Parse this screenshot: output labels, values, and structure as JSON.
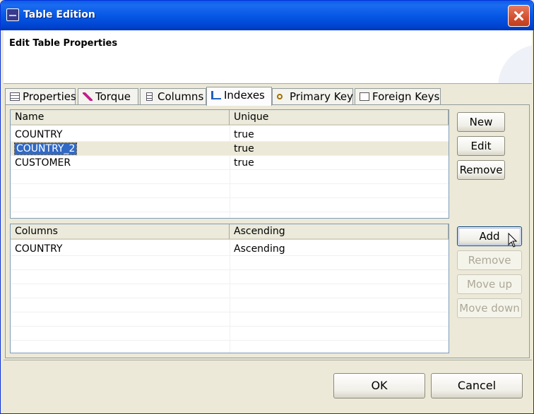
{
  "window": {
    "title": "Table Edition"
  },
  "header": {
    "title": "Edit Table Properties"
  },
  "tabs": [
    {
      "label": "Properties",
      "icon": "table-icon"
    },
    {
      "label": "Torque",
      "icon": "torque-icon"
    },
    {
      "label": "Columns",
      "icon": "columns-icon"
    },
    {
      "label": "Indexes",
      "icon": "indexes-icon"
    },
    {
      "label": "Primary Key",
      "icon": "key-icon"
    },
    {
      "label": "Foreign Keys",
      "icon": "foreign-key-icon"
    }
  ],
  "selected_tab": "Indexes",
  "indexes_table": {
    "headers": [
      "Name",
      "Unique"
    ],
    "rows": [
      {
        "name": "COUNTRY",
        "unique": "true"
      },
      {
        "name": "COUNTRY_2",
        "unique": "true"
      },
      {
        "name": "CUSTOMER",
        "unique": "true"
      }
    ],
    "selected_row": "COUNTRY_2"
  },
  "index_buttons": {
    "new": "New",
    "edit": "Edit",
    "remove": "Remove"
  },
  "columns_table": {
    "headers": [
      "Columns",
      "Ascending"
    ],
    "rows": [
      {
        "column": "COUNTRY",
        "ascending": "Ascending"
      }
    ]
  },
  "column_buttons": {
    "add": "Add",
    "remove": "Remove",
    "move_up": "Move up",
    "move_down": "Move down"
  },
  "dialog_buttons": {
    "ok": "OK",
    "cancel": "Cancel"
  }
}
